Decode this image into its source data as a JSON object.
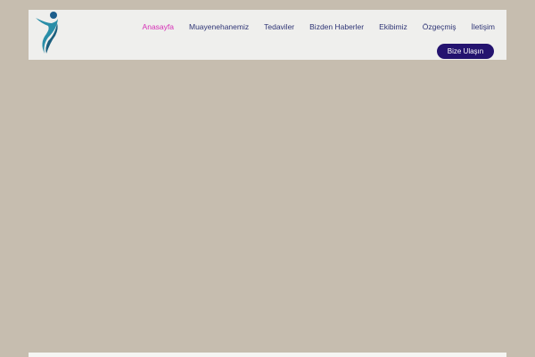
{
  "nav": {
    "items": [
      {
        "label": "Anasayfa",
        "active": true
      },
      {
        "label": "Muayenehanemiz"
      },
      {
        "label": "Tedaviler"
      },
      {
        "label": "Bizden Haberler"
      },
      {
        "label": "Ekibimiz"
      },
      {
        "label": "Özgeçmiş"
      },
      {
        "label": "İletişim"
      }
    ]
  },
  "cta": {
    "label": "Bize Ulaşın"
  },
  "colors": {
    "accent": "#d62fb6",
    "nav": "#2e3475",
    "button": "#24136f",
    "background": "#c6bdaf"
  }
}
